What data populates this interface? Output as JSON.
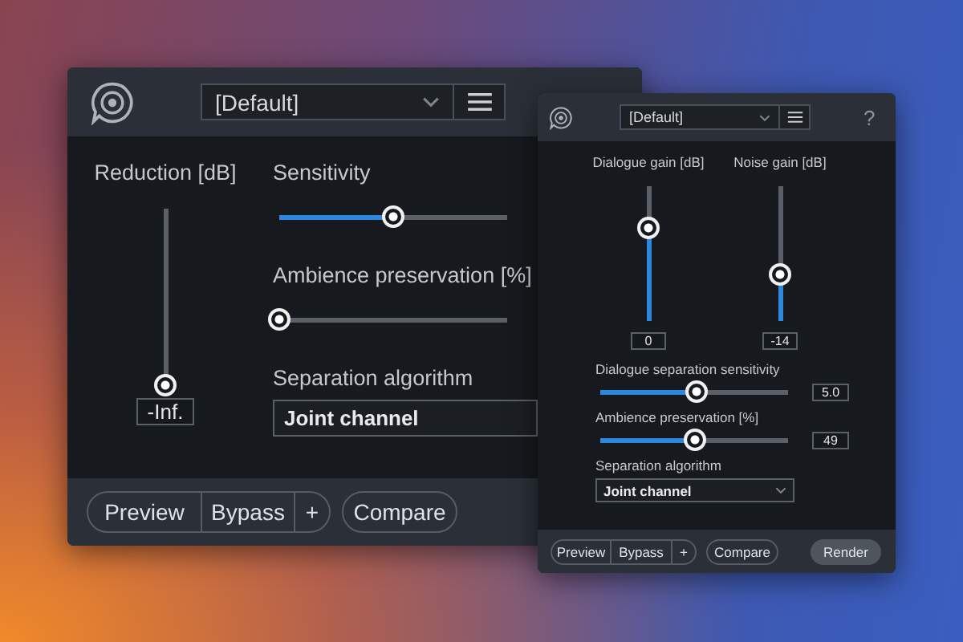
{
  "windows": [
    {
      "kind": "large",
      "preset": "[Default]",
      "gains": [
        {
          "label": "Reduction [dB]",
          "level": 0,
          "reading": "-Inf."
        }
      ],
      "sliders": [
        {
          "label": "Sensitivity",
          "level": 0.5
        },
        {
          "label": "Ambience preservation [%]",
          "level": 0
        }
      ],
      "algorithm": {
        "label": "Separation algorithm",
        "value": "Joint channel"
      },
      "footer": {
        "buttons": [
          "Preview",
          "Bypass",
          "+"
        ],
        "compare": "Compare"
      }
    },
    {
      "kind": "compact",
      "preset": "[Default]",
      "help": "?",
      "gains": [
        {
          "label": "Dialogue gain [dB]",
          "level": 0.69,
          "reading": "0"
        },
        {
          "label": "Noise gain [dB]",
          "level": 0.35,
          "reading": "-14"
        }
      ],
      "sliders": [
        {
          "label": "Dialogue separation sensitivity",
          "level": 0.51,
          "reading": "5.0"
        },
        {
          "label": "Ambience preservation [%]",
          "level": 0.5,
          "reading": "49"
        }
      ],
      "algorithm": {
        "label": "Separation algorithm",
        "value": "Joint channel"
      },
      "footer": {
        "buttons": [
          "Preview",
          "Bypass",
          "+"
        ],
        "compare": "Compare",
        "render": "Render"
      }
    }
  ]
}
